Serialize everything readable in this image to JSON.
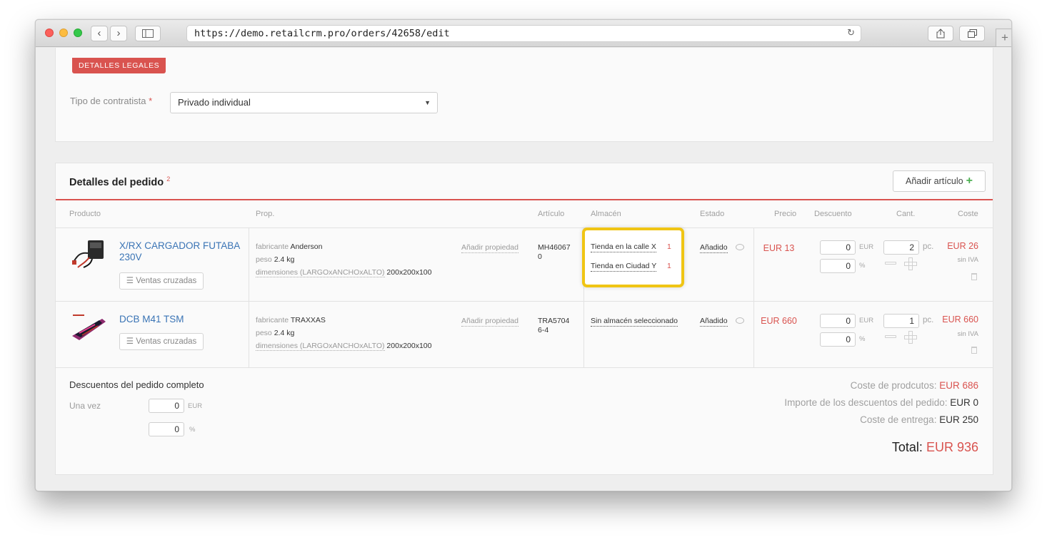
{
  "browser": {
    "url": "https://demo.retailcrm.pro/orders/42658/edit"
  },
  "legal": {
    "badge": "DETALLES LEGALES",
    "contractor_label": "Tipo de contratista",
    "required_mark": "*",
    "contractor_value": "Privado individual"
  },
  "order": {
    "title": "Detalles del pedido",
    "title_count": "2",
    "add_button": "Añadir artículo",
    "headers": {
      "product": "Producto",
      "prop": "Prop.",
      "article": "Artículo",
      "warehouse": "Almacén",
      "status": "Estado",
      "price": "Precio",
      "discount": "Descuento",
      "qty": "Cant.",
      "cost": "Coste"
    },
    "items": [
      {
        "name": "X/RX CARGADOR FUTABA 230V",
        "cross_sell": "Ventas cruzadas",
        "props": [
          {
            "key": "fabricante",
            "value": "Anderson"
          },
          {
            "key": "peso",
            "value": "2.4 kg"
          },
          {
            "key": "dimensiones (LARGOxANCHOxALTO)",
            "value": "200x200x100"
          }
        ],
        "add_property": "Añadir propiedad",
        "sku_line1": "MH46067",
        "sku_line2": "0",
        "stores": [
          {
            "name": "Tienda en la calle X",
            "count": "1"
          },
          {
            "name": "Tienda en Ciudad Y",
            "count": "1"
          }
        ],
        "status": "Añadido",
        "price": "EUR 13",
        "discount_eur": "0",
        "discount_pct": "0",
        "discount_eur_unit": "EUR",
        "discount_pct_unit": "%",
        "qty": "2",
        "qty_unit": "pc.",
        "cost": "EUR 26",
        "tax_note": "sin IVA"
      },
      {
        "name": "DCB M41 TSM",
        "cross_sell": "Ventas cruzadas",
        "props": [
          {
            "key": "fabricante",
            "value": "TRAXXAS"
          },
          {
            "key": "peso",
            "value": "2.4 kg"
          },
          {
            "key": "dimensiones (LARGOxANCHOxALTO)",
            "value": "200x200x100"
          }
        ],
        "add_property": "Añadir propiedad",
        "sku_line1": "TRA5704",
        "sku_line2": "6-4",
        "store": "Sin almacén seleccionado",
        "status": "Añadido",
        "price": "EUR 660",
        "discount_eur": "0",
        "discount_pct": "0",
        "discount_eur_unit": "EUR",
        "discount_pct_unit": "%",
        "qty": "1",
        "qty_unit": "pc.",
        "cost": "EUR 660",
        "tax_note": "sin IVA"
      }
    ],
    "footer": {
      "title": "Descuentos del pedido completo",
      "once_label": "Una vez",
      "once_eur": "0",
      "once_eur_unit": "EUR",
      "once_pct": "0",
      "once_pct_unit": "%",
      "products_cost_label": "Coste de prodcutos:",
      "products_cost": "EUR 686",
      "discount_import_label": "Importe de los descuentos del pedido:",
      "discount_import": "EUR 0",
      "delivery_label": "Coste de entrega:",
      "delivery": "EUR 250",
      "total_label": "Total:",
      "total": "EUR 936"
    }
  },
  "colors": {
    "accent_red": "#d9534f",
    "link_blue": "#3a74b5",
    "highlight_yellow": "#f0c514"
  }
}
